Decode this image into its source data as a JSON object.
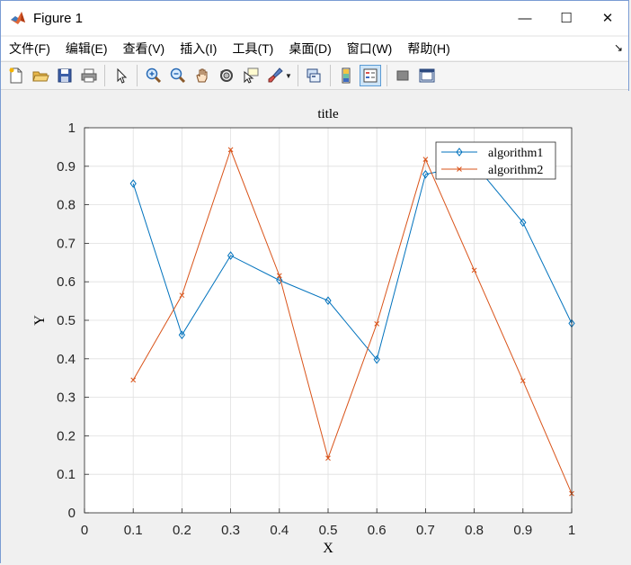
{
  "window": {
    "title": "Figure 1",
    "controls": {
      "minimize": "—",
      "maximize": "☐",
      "close": "✕"
    }
  },
  "menu": {
    "items": [
      "文件(F)",
      "编辑(E)",
      "查看(V)",
      "插入(I)",
      "工具(T)",
      "桌面(D)",
      "窗口(W)",
      "帮助(H)"
    ]
  },
  "toolbar": {
    "icons": [
      "new-file-icon",
      "open-folder-icon",
      "save-icon",
      "print-icon",
      "pointer-icon",
      "zoom-in-icon",
      "zoom-out-icon",
      "pan-hand-icon",
      "rotate-3d-icon",
      "data-cursor-icon",
      "brush-icon",
      "link-plot-icon",
      "colorbar-icon",
      "legend-icon",
      "hide-plot-tools-icon",
      "show-plot-tools-icon"
    ]
  },
  "colors": {
    "series1": "#0072bd",
    "series2": "#d95319",
    "grid": "#dfdfdf",
    "axes": "#262626"
  },
  "chart_data": {
    "type": "line",
    "title": "title",
    "xlabel": "X",
    "ylabel": "Y",
    "xlim": [
      0,
      1
    ],
    "ylim": [
      0,
      1
    ],
    "xticks": [
      "0",
      "0.1",
      "0.2",
      "0.3",
      "0.4",
      "0.5",
      "0.6",
      "0.7",
      "0.8",
      "0.9",
      "1"
    ],
    "yticks": [
      "0",
      "0.1",
      "0.2",
      "0.3",
      "0.4",
      "0.5",
      "0.6",
      "0.7",
      "0.8",
      "0.9",
      "1"
    ],
    "grid": true,
    "legend_position": "top-right",
    "x": [
      0.1,
      0.2,
      0.3,
      0.4,
      0.5,
      0.6,
      0.7,
      0.8,
      0.9,
      1.0
    ],
    "series": [
      {
        "name": "algorithm1",
        "marker": "diamond",
        "color": "#0072bd",
        "values": [
          0.855,
          0.462,
          0.668,
          0.604,
          0.551,
          0.398,
          0.879,
          0.906,
          0.754,
          0.492
        ]
      },
      {
        "name": "algorithm2",
        "marker": "x",
        "color": "#d95319",
        "values": [
          0.345,
          0.565,
          0.943,
          0.616,
          0.142,
          0.491,
          0.918,
          0.63,
          0.343,
          0.05
        ]
      }
    ]
  }
}
